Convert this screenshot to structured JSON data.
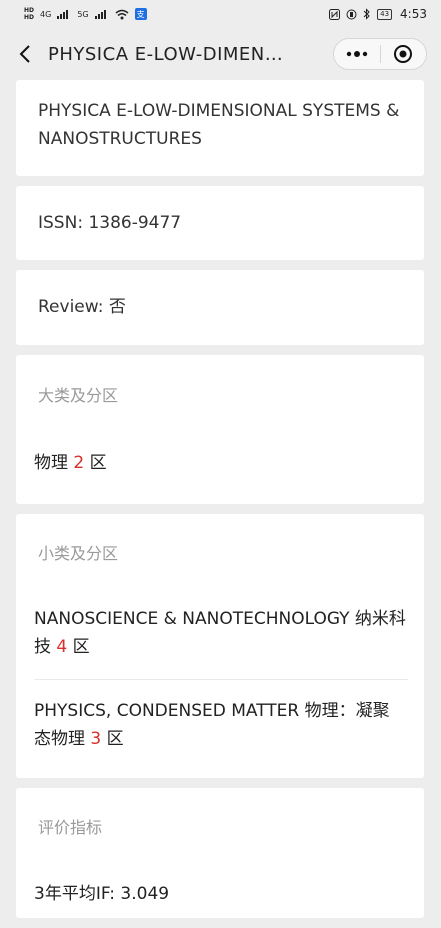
{
  "status_bar": {
    "network_1": "4G",
    "network_2": "5G",
    "time": "4:53",
    "battery": "43"
  },
  "nav": {
    "title": "PHYSICA E-LOW-DIMEN…"
  },
  "journal": {
    "full_name": "PHYSICA E-LOW-DIMENSIONAL SYSTEMS & NANOSTRUCTURES",
    "issn": "ISSN: 1386-9477",
    "review": "Review: 否"
  },
  "major_category": {
    "label": "大类及分区",
    "subject": "物理",
    "zone": "2",
    "suffix": "区"
  },
  "minor_category": {
    "label": "小类及分区",
    "items": [
      {
        "subject": "NANOSCIENCE & NANOTECHNOLOGY 纳米科技",
        "zone": "4",
        "suffix": "区"
      },
      {
        "subject": "PHYSICS, CONDENSED MATTER 物理：凝聚态物理",
        "zone": "3",
        "suffix": "区"
      }
    ]
  },
  "metrics": {
    "label": "评价指标",
    "avg_if": "3年平均IF: 3.049"
  }
}
